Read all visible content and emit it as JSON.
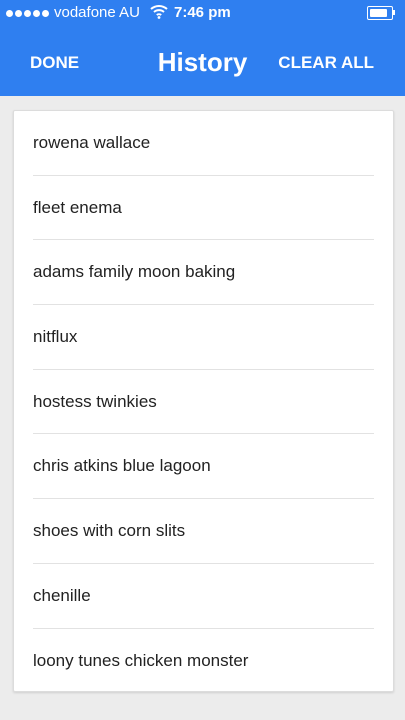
{
  "status_bar": {
    "carrier": "vodafone AU",
    "time": "7:46 pm",
    "signal_dots": 5,
    "wifi_icon": "wifi-icon",
    "battery_level": 0.85
  },
  "header": {
    "title": "History",
    "done_label": "DONE",
    "clear_label": "CLEAR ALL",
    "background_color": "#2f7ff0"
  },
  "history": {
    "items": [
      "rowena wallace",
      "fleet enema",
      "adams family moon baking",
      "nitflux",
      "hostess twinkies",
      "chris atkins blue lagoon",
      "shoes with corn slits",
      "chenille",
      "loony tunes chicken monster"
    ]
  }
}
